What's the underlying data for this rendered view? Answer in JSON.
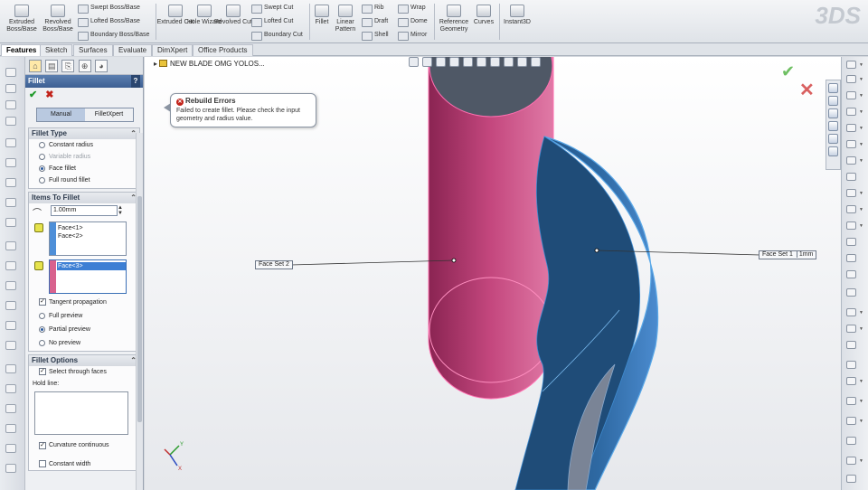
{
  "ribbon": {
    "extruded_boss": "Extruded Boss/Base",
    "revolved_boss": "Revolved Boss/Base",
    "swept_boss": "Swept Boss/Base",
    "lofted_boss": "Lofted Boss/Base",
    "boundary_boss": "Boundary Boss/Base",
    "extruded_cut": "Extruded Cut",
    "hole_wizard": "Hole Wizard",
    "revolved_cut": "Revolved Cut",
    "swept_cut": "Swept Cut",
    "lofted_cut": "Lofted Cut",
    "boundary_cut": "Boundary Cut",
    "fillet": "Fillet",
    "linear_pattern": "Linear Pattern",
    "rib": "Rib",
    "draft": "Draft",
    "shell": "Shell",
    "wrap": "Wrap",
    "dome": "Dome",
    "mirror": "Mirror",
    "reference_geometry": "Reference Geometry",
    "curves": "Curves",
    "instant3d": "Instant3D",
    "logo": "3DS"
  },
  "tabs": [
    "Features",
    "Sketch",
    "Surfaces",
    "Evaluate",
    "DimXpert",
    "Office Products"
  ],
  "property_manager": {
    "title": "Fillet",
    "help": "?",
    "ok": "✔",
    "cancel": "✖",
    "mode_manual": "Manual",
    "mode_filletxpert": "FilletXpert",
    "fillet_type": {
      "header": "Fillet Type",
      "options": [
        {
          "label": "Constant radius",
          "selected": false,
          "enabled": true
        },
        {
          "label": "Variable radius",
          "selected": false,
          "enabled": false
        },
        {
          "label": "Face fillet",
          "selected": true,
          "enabled": true
        },
        {
          "label": "Full round fillet",
          "selected": false,
          "enabled": true
        }
      ]
    },
    "items_to_fillet": {
      "header": "Items To Fillet",
      "radius": "1.00mm",
      "face_set_1": [
        "Face<1>",
        "Face<2>"
      ],
      "face_set_2": [
        "Face<3>"
      ],
      "tangent_propagation": "Tangent propagation",
      "preview_options": [
        {
          "label": "Full preview",
          "selected": false
        },
        {
          "label": "Partial preview",
          "selected": true
        },
        {
          "label": "No preview",
          "selected": false
        }
      ]
    },
    "fillet_options": {
      "header": "Fillet Options",
      "select_through_faces": "Select through faces",
      "hold_line": "Hold line:",
      "curvature_continuous": "Curvature continuous",
      "constant_width": "Constant width"
    }
  },
  "graphics": {
    "tree_node": "NEW BLADE OMG YOLOS...",
    "tooltip_title": "Rebuild Errors",
    "tooltip_body": "Failed to create fillet. Please check the input geometry and radius value.",
    "callout_set2": "Face Set 2",
    "callout_set1": "Face Set 1",
    "callout_set1_value": "1mm",
    "colors": {
      "cylinder": "#c4477e",
      "blade": "#2f6aa4",
      "blade_edge": "#5aa8e8"
    }
  }
}
